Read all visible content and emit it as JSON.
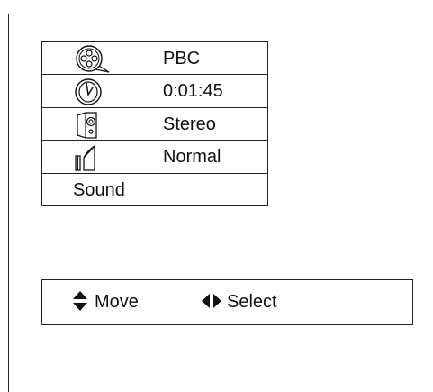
{
  "menu": {
    "items": [
      {
        "icon": "film-reel-icon",
        "label": "PBC"
      },
      {
        "icon": "clock-icon",
        "label": "0:01:45"
      },
      {
        "icon": "speaker-icon",
        "label": "Stereo"
      },
      {
        "icon": "surround-speaker-icon",
        "label": "Normal"
      },
      {
        "icon": "",
        "label": "Sound"
      }
    ]
  },
  "footer": {
    "move_label": "Move",
    "select_label": "Select",
    "move_icon": "up-down-arrows-icon",
    "select_icon": "left-right-arrows-icon"
  }
}
